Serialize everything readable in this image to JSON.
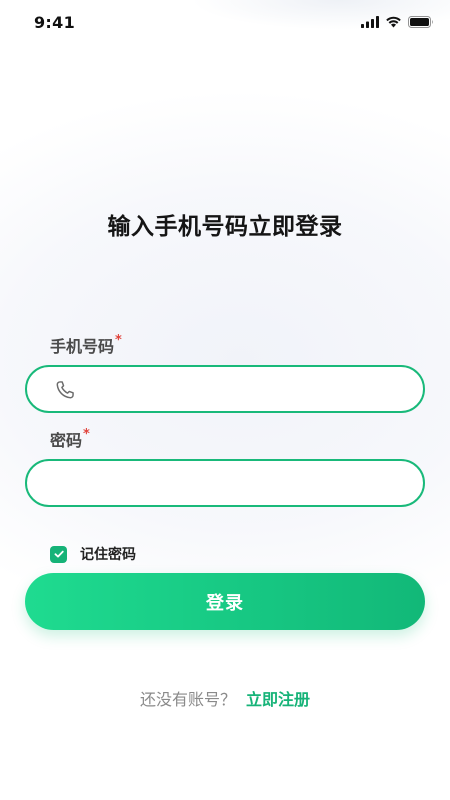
{
  "status_bar": {
    "time": "9:41",
    "icons": [
      "cellular-signal-icon",
      "wifi-icon",
      "battery-icon"
    ]
  },
  "page": {
    "title": "输入手机号码立即登录"
  },
  "form": {
    "phone": {
      "label": "手机号码",
      "required_mark": "*",
      "value": "",
      "placeholder": "",
      "icon": "phone-icon"
    },
    "password": {
      "label": "密码",
      "required_mark": "*",
      "value": "",
      "placeholder": ""
    },
    "remember": {
      "label": "记住密码",
      "checked": true,
      "icon": "check-icon"
    },
    "submit_label": "登录"
  },
  "register": {
    "prompt": "还没有账号？",
    "link_label": "立即注册"
  },
  "colors": {
    "accent": "#16b378",
    "button_gradient_start": "#1fdb90",
    "button_gradient_end": "#12b878",
    "required": "#e0433b",
    "label": "#4a4a4a",
    "prompt": "#8a8a8a"
  }
}
